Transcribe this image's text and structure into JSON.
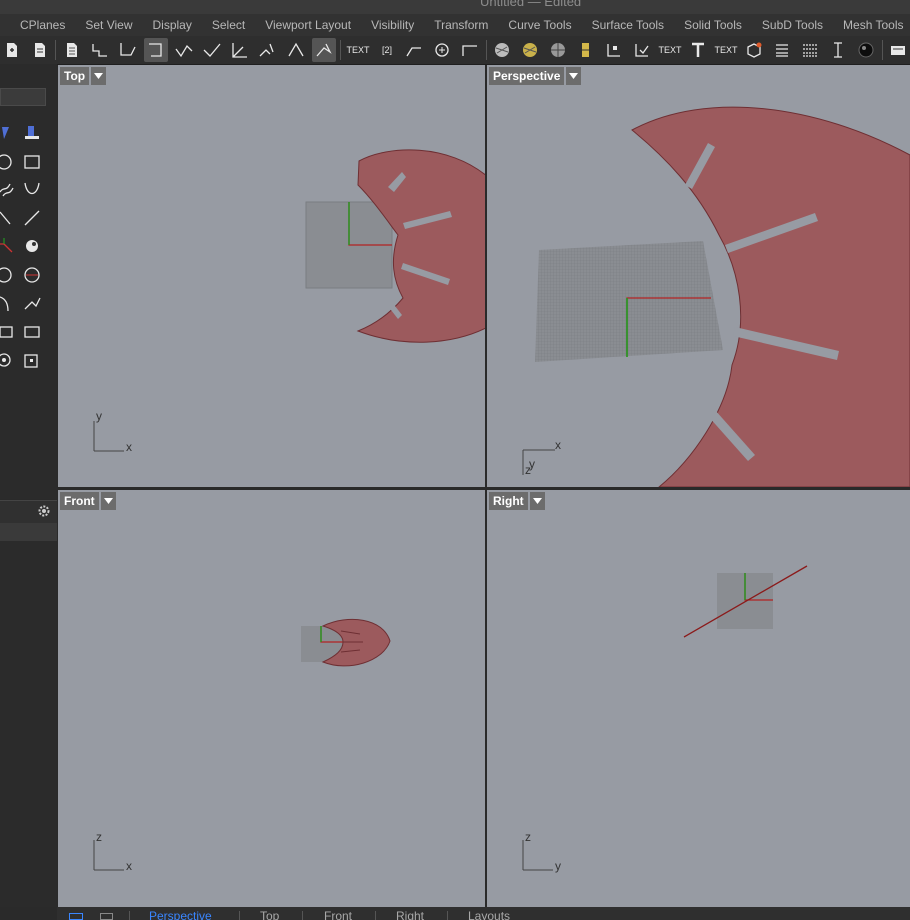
{
  "window": {
    "title": "Untitled — Edited"
  },
  "menu_tabs": [
    "CPlanes",
    "Set View",
    "Display",
    "Select",
    "Viewport Layout",
    "Visibility",
    "Transform",
    "Curve Tools",
    "Surface Tools",
    "Solid Tools",
    "SubD Tools",
    "Mesh Tools"
  ],
  "toolbar": {
    "text_tool_1": "TEXT",
    "text_tool_2": "TEXT",
    "text_tool_3": "TEXT",
    "dim_label": "[2]"
  },
  "viewports": {
    "top": {
      "name": "Top",
      "axis_a": "y",
      "axis_b": "x"
    },
    "perspective": {
      "name": "Perspective",
      "axis_a": "x",
      "axis_b": "y",
      "axis_c": "z"
    },
    "front": {
      "name": "Front",
      "axis_a": "z",
      "axis_b": "x"
    },
    "right": {
      "name": "Right",
      "axis_a": "z",
      "axis_b": "y"
    }
  },
  "status_tabs": [
    "Perspective",
    "Top",
    "Front",
    "Right",
    "Layouts"
  ],
  "icons": [
    "gear-icon",
    "dropdown-arrow-icon",
    "new-document-icon",
    "text-tool-icon"
  ],
  "colors": {
    "shape_fill": "#9c5a5d",
    "shape_stroke": "#6e2f33",
    "x_axis": "#b22222",
    "y_axis": "#1a9e1a",
    "viewport_bg": "#979ba3",
    "active_tab": "#3a86ff"
  }
}
